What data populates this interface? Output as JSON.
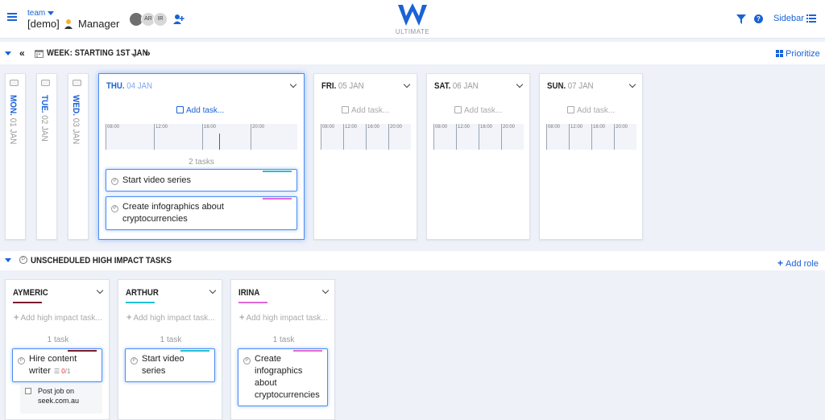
{
  "header": {
    "team_label": "team",
    "team_name": "[demo]",
    "role": "Manager",
    "avatars": [
      "",
      "AR",
      "IR"
    ],
    "logo_sub": "ULTIMATE",
    "sidebar_label": "Sidebar",
    "help_glyph": "?"
  },
  "week": {
    "prev_glyph": "«",
    "next_glyph": "»",
    "title": "WEEK: STARTING 1ST JAN",
    "prioritize_label": "Prioritize"
  },
  "days_collapsed": [
    {
      "day": "MON.",
      "date": "01 JAN"
    },
    {
      "day": "TUE.",
      "date": "02 JAN"
    },
    {
      "day": "WED.",
      "date": "03 JAN"
    }
  ],
  "days": [
    {
      "day": "THU.",
      "date": "04 JAN",
      "add_label": "Add task...",
      "hours": [
        "08:00",
        "12:00",
        "16:00",
        "20:00"
      ],
      "task_count": "2 tasks",
      "tasks": [
        {
          "text": "Start video series",
          "color": "#22c1d6"
        },
        {
          "text": "Create infographics about cryptocurrencies",
          "color": "#e06ad6"
        }
      ]
    },
    {
      "day": "FRI.",
      "date": "05 JAN",
      "add_label": "Add task...",
      "hours": [
        "08:00",
        "12:00",
        "16:00",
        "20:00"
      ]
    },
    {
      "day": "SAT.",
      "date": "06 JAN",
      "add_label": "Add task...",
      "hours": [
        "08:00",
        "12:00",
        "16:00",
        "20:00"
      ]
    },
    {
      "day": "SUN.",
      "date": "07 JAN",
      "add_label": "Add task...",
      "hours": [
        "08:00",
        "12:00",
        "16:00",
        "20:00"
      ]
    }
  ],
  "unscheduled": {
    "title": "UNSCHEDULED HIGH IMPACT TASKS",
    "add_role_label": "Add role",
    "add_hi_label": "Add high impact task...",
    "roles": [
      {
        "name": "AYMERIC",
        "color": "#7a1c2e",
        "count": "1 task",
        "task": {
          "text": "Hire content writer",
          "subtask_done": "0",
          "subtask_total": "/1"
        },
        "subtask": "Post job on seek.com.au"
      },
      {
        "name": "ARTHUR",
        "color": "#22c1d6",
        "count": "1 task",
        "task": {
          "text": "Start video series"
        }
      },
      {
        "name": "IRINA",
        "color": "#e06ad6",
        "count": "1 task",
        "task": {
          "text": "Create infographics about cryptocurrencies"
        }
      }
    ]
  },
  "colors": {
    "accent": "#1a62d6",
    "now_line": "#ee2233"
  }
}
